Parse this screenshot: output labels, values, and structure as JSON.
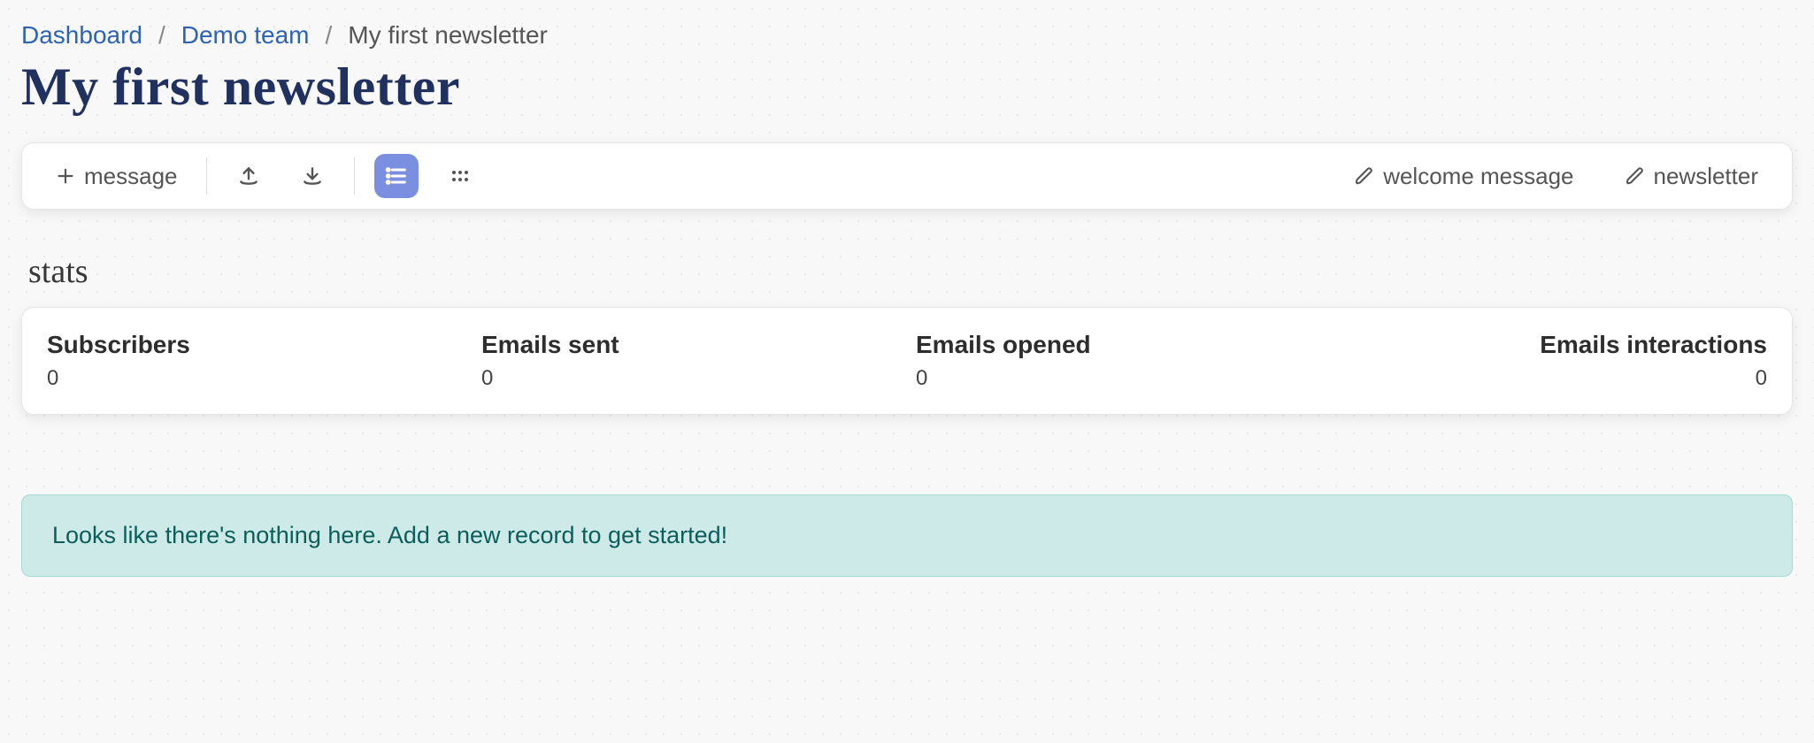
{
  "breadcrumb": {
    "items": [
      {
        "label": "Dashboard",
        "link": true
      },
      {
        "label": "Demo team",
        "link": true
      },
      {
        "label": "My first newsletter",
        "link": false
      }
    ]
  },
  "title": "My first newsletter",
  "toolbar": {
    "message_label": "message",
    "welcome_label": "welcome message",
    "newsletter_label": "newsletter"
  },
  "stats_heading": "stats",
  "stats": [
    {
      "label": "Subscribers",
      "value": "0"
    },
    {
      "label": "Emails sent",
      "value": "0"
    },
    {
      "label": "Emails opened",
      "value": "0"
    },
    {
      "label": "Emails interactions",
      "value": "0"
    }
  ],
  "empty_message": "Looks like there's nothing here. Add a new record to get started!"
}
